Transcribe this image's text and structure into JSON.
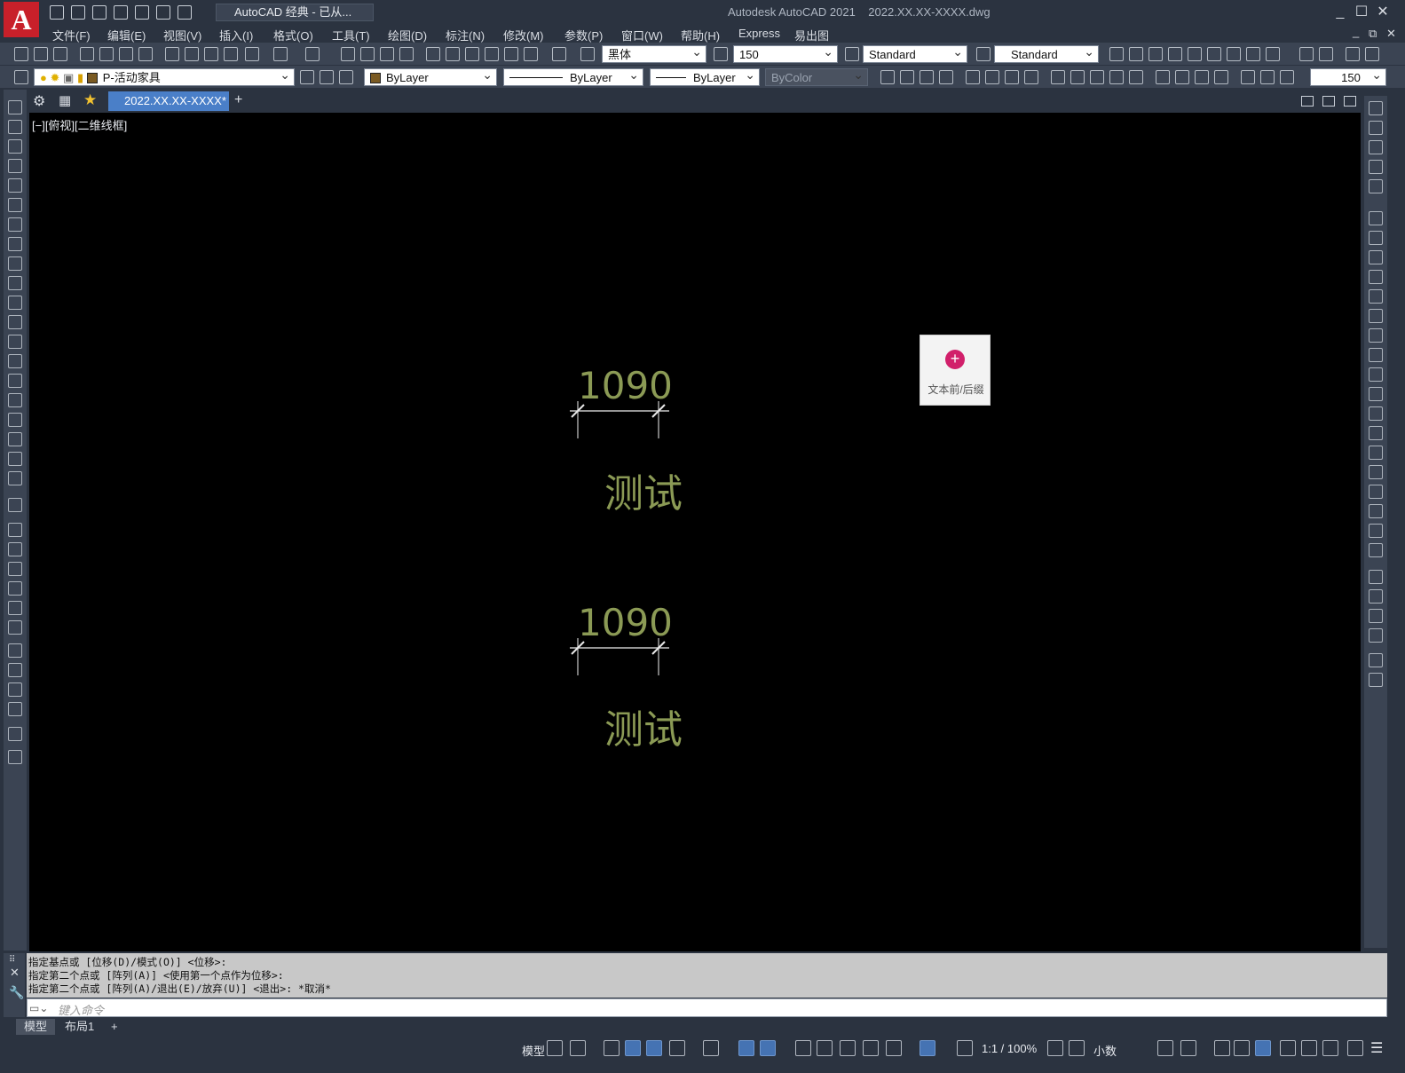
{
  "app": {
    "logo_letter": "A",
    "title": "Autodesk AutoCAD 2021",
    "file_name": "2022.XX.XX-XXXX.dwg",
    "workspace": "AutoCAD 经典 - 已从...",
    "window_buttons": {
      "minimize": "_",
      "maximize": "☐",
      "close": "✕"
    },
    "doc_buttons": {
      "minimize": "_",
      "restore": "⧉",
      "close": "✕"
    }
  },
  "menu": [
    "文件(F)",
    "编辑(E)",
    "视图(V)",
    "插入(I)",
    "格式(O)",
    "工具(T)",
    "绘图(D)",
    "标注(N)",
    "修改(M)",
    "参数(P)",
    "窗口(W)",
    "帮助(H)",
    "Express",
    "易出图"
  ],
  "toolbar1": {
    "text_style": "黑体",
    "text_height": "150",
    "table_style": "Standard",
    "mleader_style": "Standard"
  },
  "toolbar2": {
    "layer": "P-活动家具",
    "color": "ByLayer",
    "linetype": "ByLayer",
    "lineweight": "ByLayer",
    "plotstyle": "ByColor",
    "dim_value": "150"
  },
  "tabs": {
    "document": "2022.XX.XX-XXXX*",
    "new_tab": "+"
  },
  "viewport": {
    "label": "[−][俯视][二维线框]",
    "dimension1": "1090",
    "text1": "测试",
    "dimension2": "1090",
    "text2": "测试"
  },
  "floating_panel": {
    "button": "+",
    "label": "文本前/后缀"
  },
  "command": {
    "history": [
      "指定基点或 [位移(D)/模式(O)] <位移>:",
      "指定第二个点或 [阵列(A)] <使用第一个点作为位移>:",
      "指定第二个点或 [阵列(A)/退出(E)/放弃(U)] <退出>: *取消*"
    ],
    "placeholder": "键入命令"
  },
  "layout_tabs": [
    "模型",
    "布局1",
    "+"
  ],
  "statusbar": {
    "model": "模型",
    "scale": "1:1 / 100%",
    "units": "小数"
  }
}
